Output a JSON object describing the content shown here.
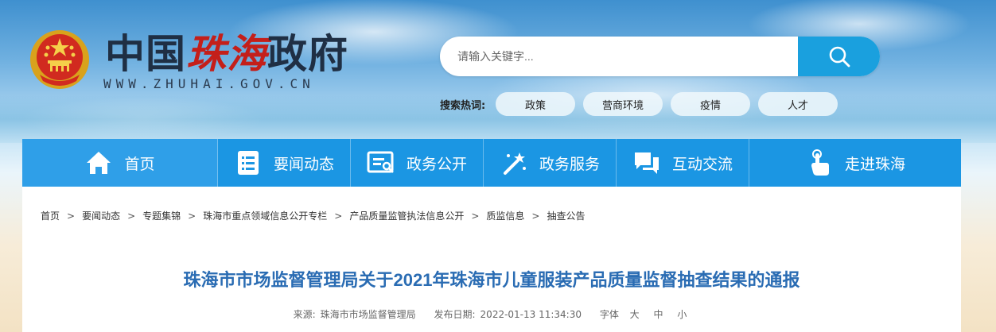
{
  "header": {
    "site_name_prefix": "中国",
    "site_name_city": "珠海",
    "site_name_suffix": "政府",
    "site_url": "WWW.ZHUHAI.GOV.CN"
  },
  "search": {
    "placeholder": "请输入关键字...",
    "hot_label": "搜索热词:",
    "hot_words": [
      "政策",
      "营商环境",
      "疫情",
      "人才"
    ]
  },
  "nav": {
    "items": [
      {
        "label": "首页",
        "icon": "home-icon"
      },
      {
        "label": "要闻动态",
        "icon": "list-document-icon"
      },
      {
        "label": "政务公开",
        "icon": "open-file-icon"
      },
      {
        "label": "政务服务",
        "icon": "magic-wand-icon"
      },
      {
        "label": "互动交流",
        "icon": "chat-bubbles-icon"
      },
      {
        "label": "走进珠海",
        "icon": "pointing-hand-icon"
      }
    ]
  },
  "breadcrumb": {
    "items": [
      "首页",
      "要闻动态",
      "专题集锦",
      "珠海市重点领域信息公开专栏",
      "产品质量监管执法信息公开",
      "质监信息",
      "抽查公告"
    ],
    "separator": ">"
  },
  "article": {
    "title": "珠海市市场监督管理局关于2021年珠海市儿童服装产品质量监督抽查结果的通报",
    "source_label": "来源:",
    "source": "珠海市市场监督管理局",
    "date_label": "发布日期:",
    "date": "2022-01-13 11:34:30",
    "font_label": "字体",
    "font_sizes": [
      "大",
      "中",
      "小"
    ]
  },
  "colors": {
    "nav_bg": "#1b96e3",
    "search_button": "#1aa0de",
    "title": "#2a6cb3",
    "city_red": "#c41f1a"
  }
}
